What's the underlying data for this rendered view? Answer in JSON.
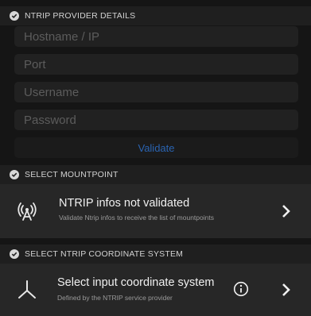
{
  "provider": {
    "header": "NTRIP PROVIDER DETAILS",
    "hostname_placeholder": "Hostname / IP",
    "port_placeholder": "Port",
    "username_placeholder": "Username",
    "password_placeholder": "Password",
    "validate_label": "Validate"
  },
  "mountpoint": {
    "header": "SELECT MOUNTPOINT",
    "title": "NTRIP infos not validated",
    "subtitle": "Validate Ntrip infos to receive the list of mountpoints"
  },
  "coordinate": {
    "header": "SELECT NTRIP COORDINATE SYSTEM",
    "title": "Select input coordinate system",
    "subtitle": "Defined by the NTRIP service provider"
  },
  "icons": {
    "check": "check-circle-icon",
    "antenna": "antenna-icon",
    "axes": "coordinate-axes-icon",
    "info": "info-icon",
    "chevron": "chevron-right-icon"
  },
  "colors": {
    "background": "#151515",
    "card": "#272727",
    "field": "#212121",
    "validate_text": "#2a63b0"
  }
}
